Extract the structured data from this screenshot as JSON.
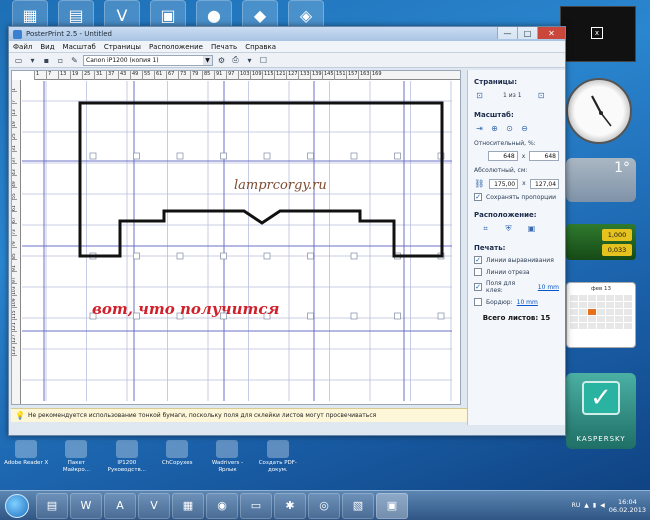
{
  "window": {
    "title": "PosterPrint 2.5 - Untitled",
    "controls": {
      "minimize": "—",
      "maximize": "□",
      "close": "✕"
    }
  },
  "menu": [
    "Файл",
    "Вид",
    "Масштаб",
    "Страницы",
    "Расположение",
    "Печать",
    "Справка"
  ],
  "toolbar": {
    "printer": "Canon iP1200 (копия 1)"
  },
  "ruler_top": [
    "1",
    "7",
    "13",
    "19",
    "25",
    "31",
    "37",
    "43",
    "49",
    "55",
    "61",
    "67",
    "73",
    "79",
    "85",
    "91",
    "97",
    "103",
    "109",
    "115",
    "121",
    "127",
    "133",
    "139",
    "145",
    "151",
    "157",
    "163",
    "169"
  ],
  "ruler_left": [
    "1",
    "7",
    "13",
    "19",
    "25",
    "31",
    "37",
    "43",
    "49",
    "55",
    "61",
    "67",
    "73",
    "79",
    "85",
    "91",
    "97",
    "103",
    "109",
    "115",
    "121",
    "127",
    "133"
  ],
  "canvas": {
    "watermark": "lamprcorgy.ru",
    "caption": "вот, что получится"
  },
  "statusbar": "Не рекомендуется использование тонкой бумаги, поскольку поля для склейки листов могут просвечиваться",
  "panel": {
    "pages_title": "Страницы:",
    "pages_value": "1 из 1",
    "scale_title": "Масштаб:",
    "relative_label": "Относительный, %:",
    "relative_w": "648",
    "relative_x": "x",
    "relative_h": "648",
    "absolute_label": "Абсолютный, см:",
    "absolute_w": "175,00",
    "absolute_x": "x",
    "absolute_h": "127,04",
    "keep_ratio": "Сохранять пропорции",
    "layout_title": "Расположение:",
    "print_title": "Печать:",
    "align_lines": "Линии выравнивания",
    "cut_lines": "Линии отреза",
    "glue_margins": "Поля для клея:",
    "glue_value": "10 mm",
    "border": "Бордюр:",
    "border_value": "10 mm",
    "total": "Всего листов: 15"
  },
  "desktop_icons": [
    {
      "label": "Adobe Reader X"
    },
    {
      "label": "Пакет Майкро..."
    },
    {
      "label": "IP1200 Руководств..."
    },
    {
      "label": "ChCopyxes"
    },
    {
      "label": "Wadrivers - Ярлык"
    },
    {
      "label": "Создать PDF-докум."
    }
  ],
  "gadgets": {
    "temperature": "1°",
    "currency_1": "1,000",
    "currency_2": "0,033",
    "calendar_month": "фев 13",
    "kaspersky": "KASPERSKY"
  },
  "taskbar": {
    "lang": "RU",
    "time": "16:04",
    "date": "06.02.2013"
  }
}
